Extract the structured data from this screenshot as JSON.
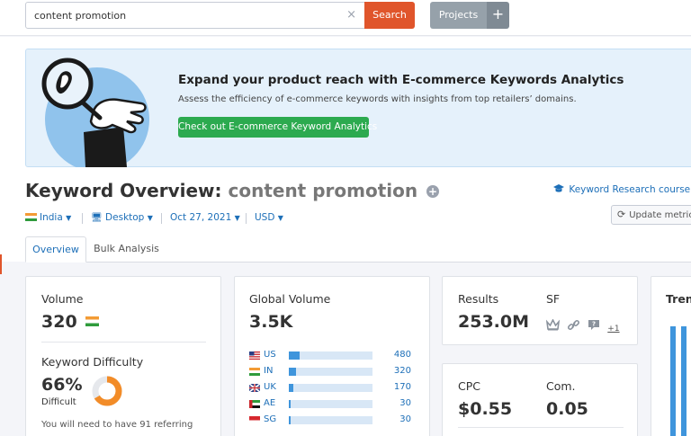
{
  "search": {
    "value": "content promotion",
    "button_label": "Search",
    "clear_icon": "×"
  },
  "projects": {
    "label": "Projects",
    "add_icon": "+"
  },
  "promo": {
    "title": "Expand your product reach with E-commerce Keywords Analytics",
    "subtitle": "Assess the efficiency of e-commerce keywords with insights from top retailers’ domains.",
    "cta_label": "Check out E-commerce Keyword Analytics"
  },
  "page": {
    "title_prefix": "Keyword Overview:",
    "keyword": "content promotion",
    "course_link": "Keyword Research course",
    "update_label": "Update metrics"
  },
  "filters": {
    "country": "India",
    "device": "Desktop",
    "date": "Oct 27, 2021",
    "currency": "USD"
  },
  "tabs": [
    {
      "label": "Overview",
      "active": true
    },
    {
      "label": "Bulk Analysis",
      "active": false
    }
  ],
  "volume_card": {
    "volume_label": "Volume",
    "volume_value": "320",
    "kd_label": "Keyword Difficulty",
    "kd_value": "66%",
    "kd_percent": 66,
    "kd_text": "Difficult",
    "kd_note": "You will need to have 91 referring"
  },
  "global_card": {
    "label": "Global Volume",
    "value": "3.5K",
    "countries": [
      {
        "code": "US",
        "value": "480",
        "share": 0.13
      },
      {
        "code": "IN",
        "value": "320",
        "share": 0.09
      },
      {
        "code": "UK",
        "value": "170",
        "share": 0.05
      },
      {
        "code": "AE",
        "value": "30",
        "share": 0.02
      },
      {
        "code": "SG",
        "value": "30",
        "share": 0.02
      }
    ]
  },
  "results_card": {
    "results_label": "Results",
    "results_value": "253.0M",
    "sf_label": "SF",
    "sf_more": "+1"
  },
  "cpc_card": {
    "cpc_label": "CPC",
    "cpc_value": "$0.55",
    "com_label": "Com.",
    "com_value": "0.05"
  },
  "trend_card": {
    "label": "Trend"
  },
  "colors": {
    "accent": "#e0552b",
    "link": "#1d6fb8",
    "cta": "#2caa4f",
    "bar": "#3f95dc",
    "difficulty": "#f28c28"
  }
}
